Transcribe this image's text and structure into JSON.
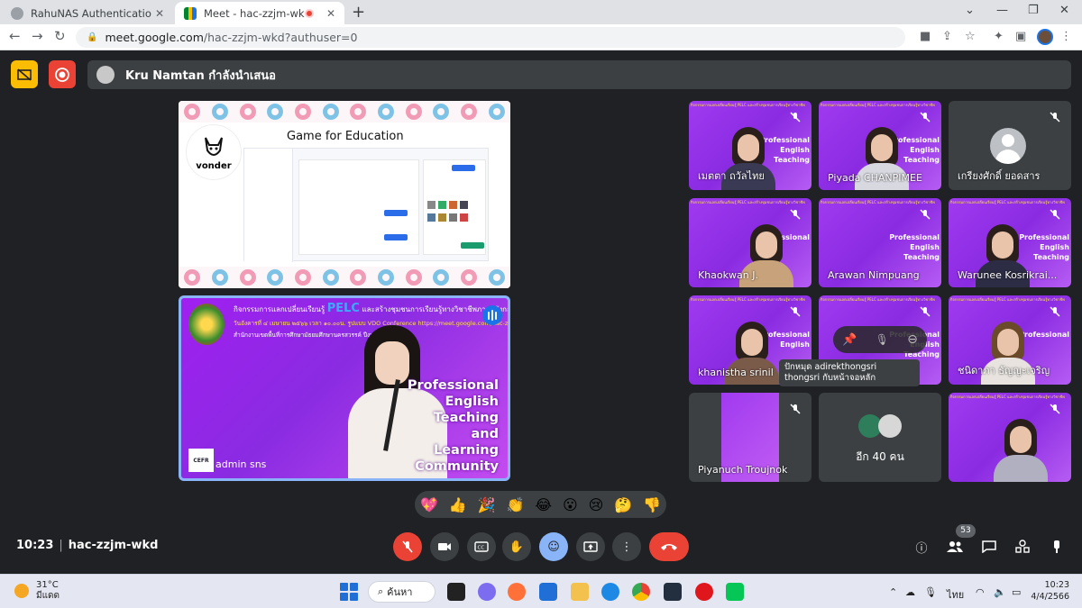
{
  "browser": {
    "tabs": [
      {
        "title": "RahuNAS Authentication",
        "favicon": "globe-icon",
        "active": false
      },
      {
        "title": "Meet - hac-zzjm-wkd",
        "favicon": "google-meet-icon",
        "active": true,
        "recording": true
      }
    ],
    "url_host": "meet.google.com",
    "url_path": "/hac-zzjm-wkd?authuser=0"
  },
  "meet": {
    "presenter_text": "Kru Namtan กำลังนำเสนอ",
    "slide": {
      "title": "Game for Education",
      "logo_text": "vonder"
    },
    "stream": {
      "header_line1_prefix": "กิจกรรมการแลกเปลี่ยนเรียนรู้",
      "header_pelc": "PELC",
      "header_line1_suffix": "และสร้างชุมชนการเรียนรู้ทางวิชาชีพภาษาอังกฤษ",
      "header_line2": "วันอังคารที่ ๔ เมษายน ๒๕๖๖ เวลา ๑๐.๐๐น. รูปแบบ VDO Conference https://meet.google.com/hac-zzjm-wkd",
      "header_line3": "สำนักงานเขตพื้นที่การศึกษามัธยมศึกษานครสวรรค์  ปีงบประมาณ ๒๕๖๖",
      "pet_lines": [
        "Professional",
        "English",
        "Teaching",
        "and",
        "Learning",
        "Community"
      ],
      "cefr": "CEFR",
      "name": "admin sns"
    },
    "tiles": [
      {
        "name": "เมตตา ถวัลไทย",
        "video": true
      },
      {
        "name": "Piyada CHANPIMEE",
        "video": true
      },
      {
        "name": "เกรียงศักดิ์ ยอดสาร",
        "video": false
      },
      {
        "name": "Khaokwan J.",
        "video": true
      },
      {
        "name": "Arawan Nimpuang",
        "video": true
      },
      {
        "name": "Warunee Kosrikrai...",
        "video": true
      },
      {
        "name": "khanistha srinil",
        "video": true
      },
      {
        "name": "",
        "video": true
      },
      {
        "name": "ชนิดาภา ธัญญะเจริญ",
        "video": true
      },
      {
        "name": "Piyanuch Troujnok",
        "video": true
      },
      {
        "name": "",
        "video": true
      }
    ],
    "tile_side_text": [
      "Professional",
      "English",
      "Teaching",
      "and",
      "Learning",
      "Community"
    ],
    "tile_banner": "กิจกรรมการแลกเปลี่ยนเรียนรู้ PELC และสร้างชุมชนการเรียนรู้ทางวิชาชีพ",
    "tooltip": "ปักหมุด adirekthongsri thongsri กับหน้าจอหลัก",
    "others_label": "อีก 40 คน",
    "reactions": [
      "💖",
      "👍",
      "🎉",
      "👏",
      "😂",
      "😮",
      "😢",
      "🤔",
      "👎"
    ],
    "meeting_time": "10:23",
    "meeting_code": "hac-zzjm-wkd",
    "participants_count": "53"
  },
  "taskbar": {
    "temperature": "31°C",
    "weather_text": "มีแดด",
    "search_label": "ค้นหา",
    "language": "ไทย",
    "time": "10:23",
    "date": "4/4/2566"
  },
  "colors": {
    "meet_bg": "#202124",
    "tile_bg": "#3c4043",
    "end_call": "#ea4335",
    "accent_blue": "#8ab4f8"
  }
}
